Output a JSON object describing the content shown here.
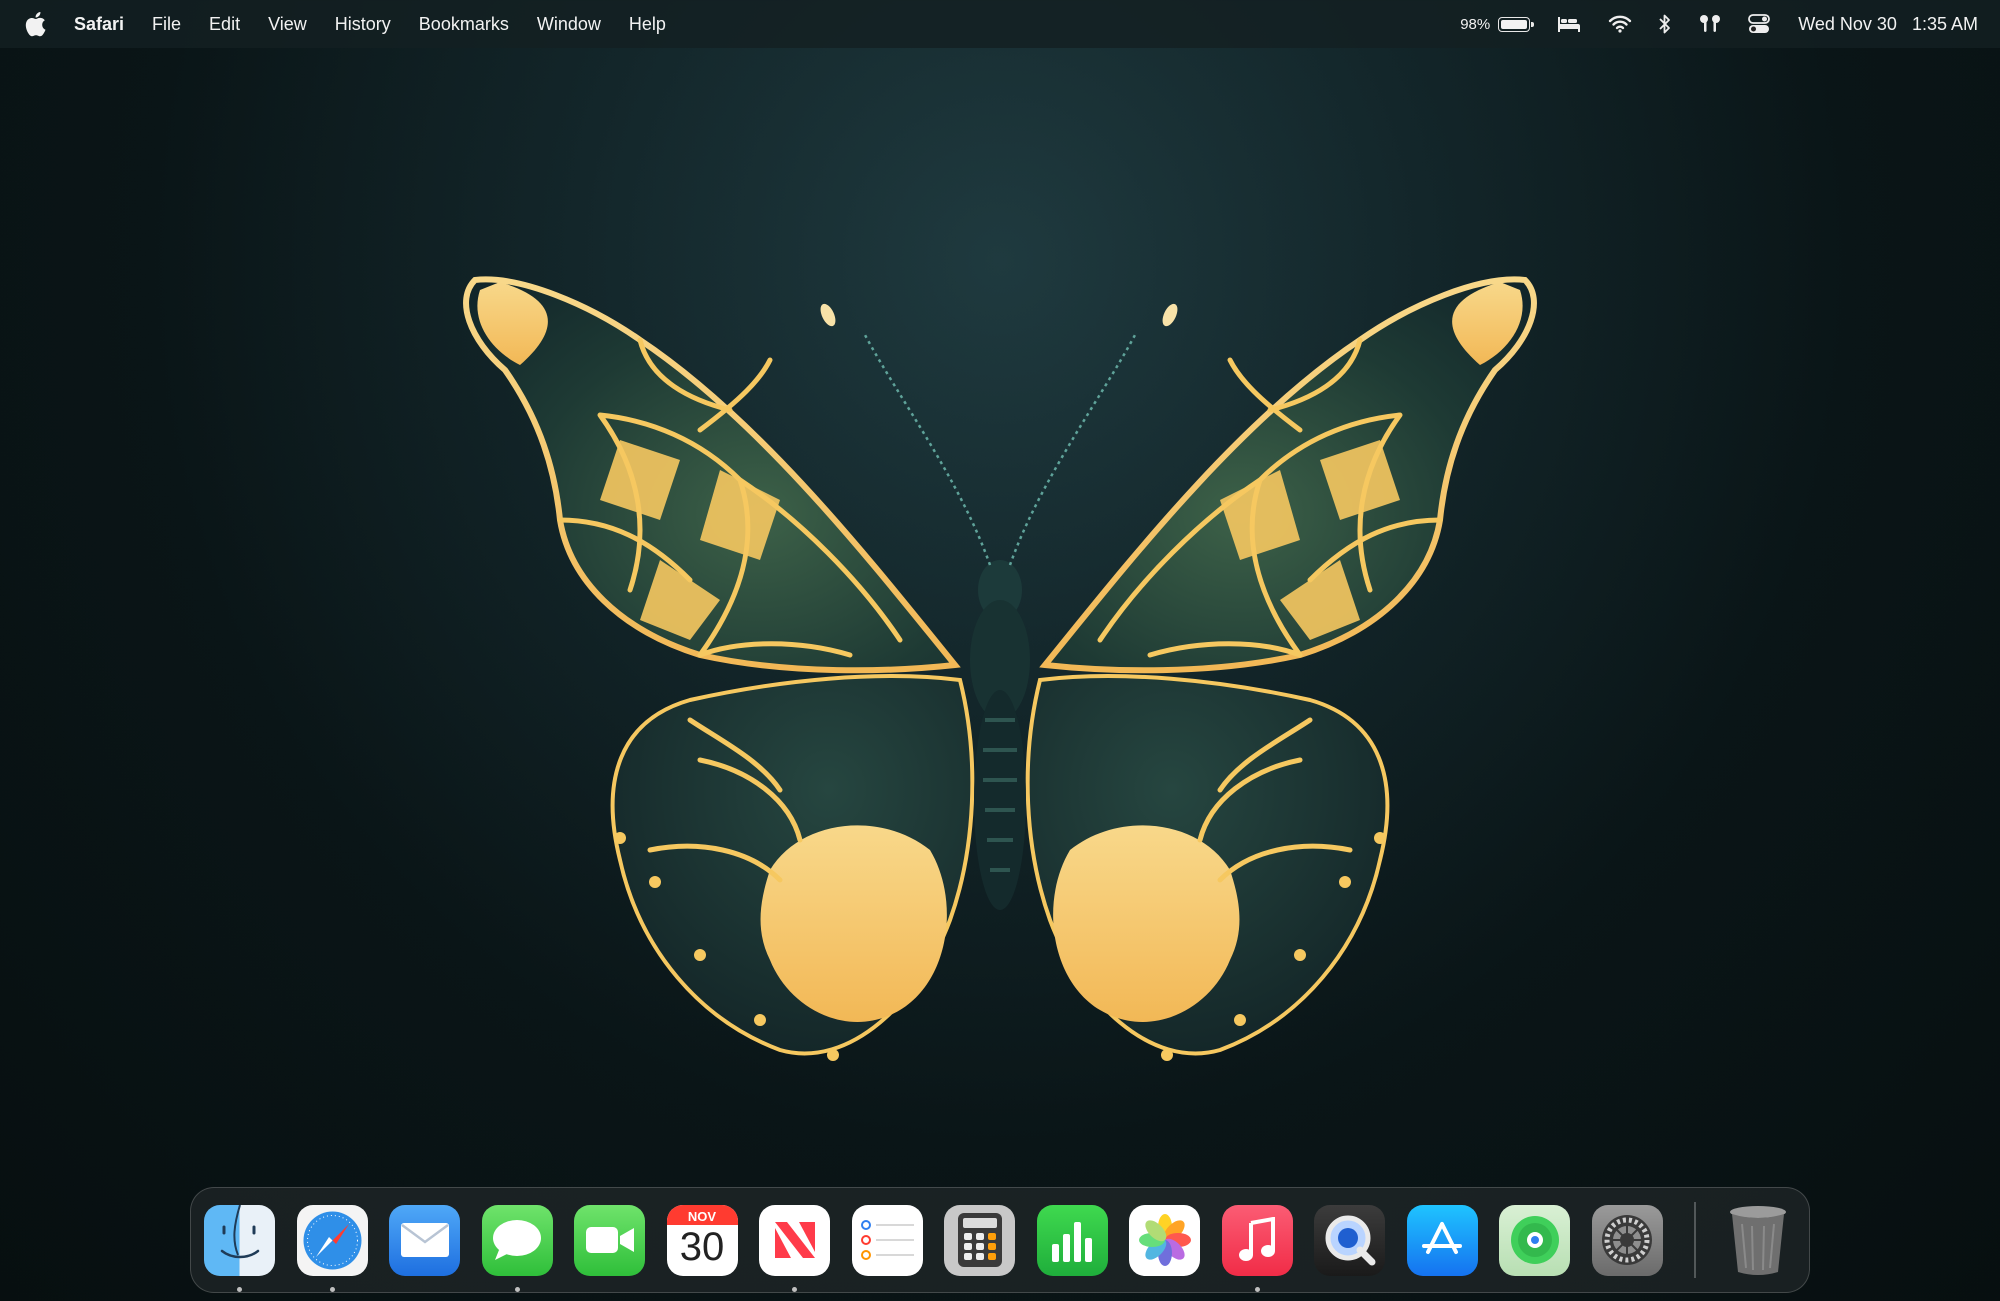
{
  "menubar": {
    "apple_icon": "apple-logo",
    "app_name": "Safari",
    "menus": [
      "File",
      "Edit",
      "View",
      "History",
      "Bookmarks",
      "Window",
      "Help"
    ],
    "status": {
      "battery_percent": "98%",
      "battery_level": 0.98,
      "icons": [
        "sleep-bed-icon",
        "wifi-icon",
        "bluetooth-icon",
        "airpods-icon",
        "control-center-icon"
      ],
      "date": "Wed Nov 30",
      "time": "1:35 AM"
    }
  },
  "wallpaper": {
    "subject": "butterfly",
    "colors": {
      "wing": "#1f3a33",
      "vein": "#f6c860",
      "background": "#0a1517"
    }
  },
  "dock": {
    "apps": [
      {
        "name": "Finder",
        "icon": "finder-icon",
        "running": true
      },
      {
        "name": "Safari",
        "icon": "safari-icon",
        "running": true
      },
      {
        "name": "Mail",
        "icon": "mail-icon",
        "running": false
      },
      {
        "name": "Messages",
        "icon": "messages-icon",
        "running": true
      },
      {
        "name": "FaceTime",
        "icon": "facetime-icon",
        "running": false
      },
      {
        "name": "Calendar",
        "icon": "calendar-icon",
        "running": false,
        "month": "NOV",
        "day": "30"
      },
      {
        "name": "News",
        "icon": "news-icon",
        "running": true
      },
      {
        "name": "Reminders",
        "icon": "reminders-icon",
        "running": false
      },
      {
        "name": "Calculator",
        "icon": "calculator-icon",
        "running": false
      },
      {
        "name": "Numbers",
        "icon": "numbers-icon",
        "running": false
      },
      {
        "name": "Photos",
        "icon": "photos-icon",
        "running": false
      },
      {
        "name": "Music",
        "icon": "music-icon",
        "running": true
      },
      {
        "name": "QuickTime Player",
        "icon": "quicktime-icon",
        "running": false
      },
      {
        "name": "App Store",
        "icon": "app-store-icon",
        "running": false
      },
      {
        "name": "Find My",
        "icon": "find-my-icon",
        "running": false
      },
      {
        "name": "System Settings",
        "icon": "system-settings-icon",
        "running": false
      }
    ],
    "trash": {
      "name": "Trash",
      "icon": "trash-icon"
    }
  }
}
